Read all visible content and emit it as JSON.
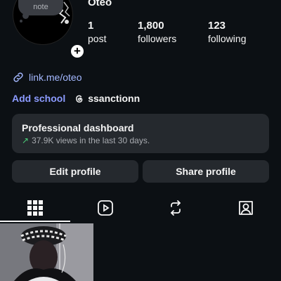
{
  "profile": {
    "username": "Oteo",
    "note_label": "note",
    "stats": [
      {
        "value": "1",
        "label": "post"
      },
      {
        "value": "1,800",
        "label": "followers"
      },
      {
        "value": "123",
        "label": "following"
      }
    ],
    "link": "link.me/oteo",
    "add_school": "Add school",
    "threads_handle": "ssanctionn"
  },
  "dashboard": {
    "title": "Professional dashboard",
    "subtitle": "37.9K views in the last 30 days."
  },
  "actions": {
    "edit_label": "Edit profile",
    "share_label": "Share profile"
  },
  "tabs": [
    "grid-icon",
    "reels-icon",
    "reposts-icon",
    "tagged-icon"
  ],
  "colors": {
    "background": "#0c1014",
    "card": "#25292e",
    "link": "#a4b8ff",
    "accent": "#8c9bff",
    "trend_up": "#4cd17a"
  }
}
